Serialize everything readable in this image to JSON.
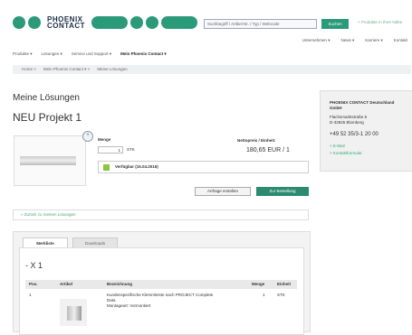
{
  "header": {
    "brand_line1": "PHOENIX",
    "brand_line2": "CONTACT",
    "search_placeholder": "Suchbegriff / Artikel-Nr. / Typ / Webcode",
    "search_button": "Suchen",
    "language": "< Produkte in Ihrer Nähe",
    "nav_top": [
      "Unternehmen ▾",
      "News ▾",
      "Karriere ▾",
      "Kontakt"
    ],
    "nav_main": [
      "Produkte ▾",
      "Lösungen ▾",
      "Service und Support ▾"
    ],
    "nav_active": "Mein Phoenix Contact ▾"
  },
  "breadcrumb": [
    "Home >",
    "Mein Phoenix Contact ▾ >",
    "Meine Lösungen"
  ],
  "main": {
    "page_title": "Meine Lösungen",
    "project_title": "NEU Projekt 1",
    "menge_label": "Menge",
    "menge_value": "1",
    "menge_unit": "STK",
    "price_label": "Nettopreis / Einheit:",
    "price_value": "180,65 EUR / 1",
    "availability": "Verfügbar (15.04.2016)",
    "btn_order": "Anfrage erstellen",
    "btn_cart": "Zur Bestellung",
    "back_link": "« Zurück zu meinen Lösungen"
  },
  "tabs": {
    "active": "Merkliste",
    "inactive": "Downloads",
    "section_title": "- X 1",
    "columns": [
      "Pos.",
      "Artikel",
      "Bezeichnung",
      "Menge",
      "Einheit"
    ],
    "rows": [
      {
        "pos": "1",
        "description_line1": "Kundenspezifische Klemmleiste nach PROJECT Complete",
        "description_line2": "Data",
        "description_line3": "Montageart: Vormontiert",
        "menge": "1",
        "einheit": "STK"
      }
    ]
  },
  "sidebar": {
    "company": "PHOENIX CONTACT Deutschland GmbH",
    "street": "Flachsmarktstraße 8",
    "city": "D-32825 Blomberg",
    "phone": "+49 52 35/3-1 20 00",
    "links": [
      "> E-Mail",
      "> Kontaktformular"
    ]
  },
  "colors": {
    "brand_green": "#2b9a78",
    "nav_bg": "#eef1f2",
    "available": "#8cc63f"
  }
}
